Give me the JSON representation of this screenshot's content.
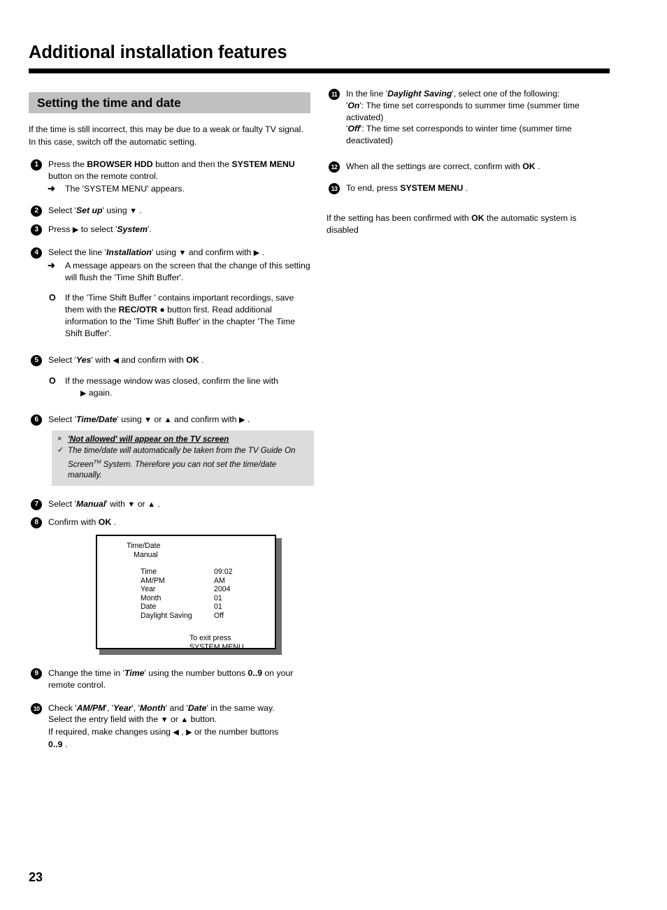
{
  "header": {
    "title": "Additional installation features"
  },
  "section": {
    "title": "Setting the time and date"
  },
  "intro": "If the time is still incorrect, this may be due to a weak or faulty TV signal. In this case, switch off the automatic setting.",
  "steps": {
    "s1": {
      "num": "1",
      "text_a": "Press the ",
      "key_a": "BROWSER HDD",
      "text_b": " button and then the ",
      "key_b": "SYSTEM MENU",
      "text_c": " button on the remote control.",
      "result": "The 'SYSTEM MENU' appears.",
      "arrow_icon": "➜"
    },
    "s2": {
      "num": "2",
      "text_a": "Select '",
      "em_a": "Set up",
      "text_b": "' using ",
      "icon": "▼",
      "text_c": " ."
    },
    "s3": {
      "num": "3",
      "text_a": "Press ",
      "icon": "▶",
      "text_b": " to select '",
      "em_a": "System",
      "text_c": "'."
    },
    "s4": {
      "num": "4",
      "text_a": "Select the line '",
      "em_a": "Installation",
      "text_b": "' using ",
      "icon_down": "▼",
      "text_c": " and confirm with ",
      "icon_right": "▶",
      "text_d": " .",
      "result": "A message appears on the screen that the change of this setting will flush the 'Time Shift Buffer'.",
      "arrow_icon": "➜",
      "tip_marker": "O",
      "tip_a": "If the 'Time Shift Buffer ' contains important recordings, save them with the ",
      "tip_key": "REC/OTR",
      "tip_dot": "●",
      "tip_b": " button first. Read additional information to the 'Time Shift Buffer' in the chapter 'The Time Shift Buffer'."
    },
    "s5": {
      "num": "5",
      "text_a": "Select '",
      "em_a": "Yes",
      "text_b": "' with ",
      "icon_left": "◀",
      "text_c": " and confirm with ",
      "key_ok": "OK",
      "text_d": " .",
      "tip_marker": "O",
      "tip_a": "If the message window was closed, confirm the line with",
      "tip_icon": "▶",
      "tip_b": " again."
    },
    "s6": {
      "num": "6",
      "text_a": "Select '",
      "em_a": "Time/Date",
      "text_b": "' using ",
      "icon_down": "▼",
      "text_c": " or ",
      "icon_up": "▲",
      "text_d": " and confirm with ",
      "icon_right": "▶",
      "text_e": " .",
      "note_x_mark": "×",
      "note_x_text": "'Not allowed' will appear on the TV screen",
      "note_check_mark": "✓",
      "note_check_text_a": "The time/date will automatically be taken from the TV Guide On Screen",
      "note_check_tm": "TM",
      "note_check_text_b": " System. Therefore you can not set the time/date manually."
    },
    "s7": {
      "num": "7",
      "text_a": "Select '",
      "em_a": "Manual",
      "text_b": "' with ",
      "icon_down": "▼",
      "text_c": " or ",
      "icon_up": "▲",
      "text_d": " ."
    },
    "s8": {
      "num": "8",
      "text_a": "Confirm with ",
      "key_ok": "OK",
      "text_b": " ."
    },
    "s9": {
      "num": "9",
      "text_a": "Change the time in '",
      "em_a": "Time",
      "text_b": "' using the number buttons ",
      "key_nums": "0..9",
      "text_c": " on your remote control."
    },
    "s10": {
      "num": "10",
      "text_a": "Check '",
      "em_a": "AM/PM",
      "text_b": "', '",
      "em_b": "Year",
      "text_c": "', '",
      "em_c": "Month",
      "text_d": "' and '",
      "em_d": "Date",
      "text_e": "' in the same way.",
      "line2_a": "Select the entry field with the ",
      "line2_icon_down": "▼",
      "line2_b": " or ",
      "line2_icon_up": "▲",
      "line2_c": " button.",
      "line3_a": "If required, make changes using ",
      "line3_icon_left": "◀",
      "line3_b": " , ",
      "line3_icon_right": "▶",
      "line3_c": " or the number buttons",
      "line4_key": "0..9",
      "line4_text": " ."
    },
    "s11": {
      "num": "11",
      "text_a": "In the line '",
      "em_a": "Daylight Saving",
      "text_b": "', select one of the following:",
      "line2_q1": "'",
      "line2_em": "On",
      "line2_rest": "': The time set corresponds to summer time (summer time activated)",
      "line3_q1": "'",
      "line3_em": "Off",
      "line3_rest": "': The time set corresponds to winter time (summer time deactivated)"
    },
    "s12": {
      "num": "12",
      "text_a": "When all the settings are correct, confirm with ",
      "key_ok": "OK",
      "text_b": " ."
    },
    "s13": {
      "num": "13",
      "text_a": "To end, press ",
      "key": "SYSTEM MENU",
      "text_b": " ."
    }
  },
  "tail_note": {
    "text_a": "If the setting has been confirmed with ",
    "key_ok": "OK",
    "text_b": " the automatic system is disabled"
  },
  "tv_screen": {
    "title": "Time/Date",
    "subtitle": "Manual",
    "rows": [
      {
        "label": "Time",
        "value": "09:02"
      },
      {
        "label": "AM/PM",
        "value": "AM"
      },
      {
        "label": "Year",
        "value": "2004"
      },
      {
        "label": "Month",
        "value": "01"
      },
      {
        "label": "Date",
        "value": "01"
      },
      {
        "label": "Daylight Saving",
        "value": "Off"
      }
    ],
    "exit_line1": "To exit press",
    "exit_line2": "SYSTEM MENU"
  },
  "page_number": "23",
  "colors": {
    "section_bar": "#c0c0c0",
    "note_box": "#dcdcdc",
    "rule": "#000000",
    "shadow": "#6e6e6e"
  }
}
